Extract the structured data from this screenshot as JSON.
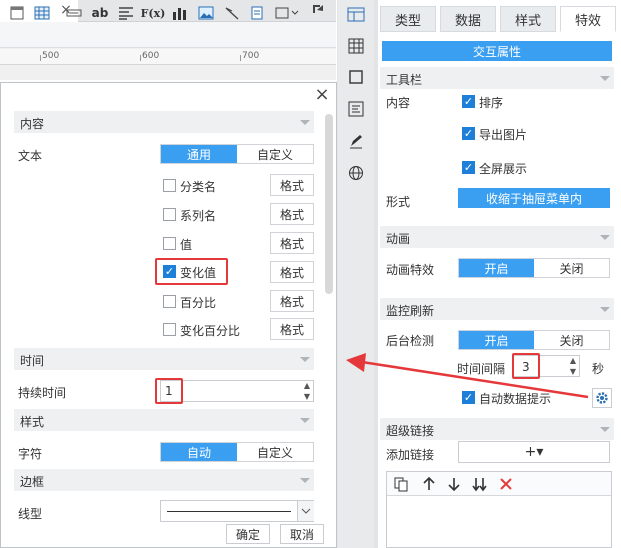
{
  "toolbar": {
    "tools": [
      "grid-icon",
      "table-icon",
      "link-icon",
      "ab",
      "text-align-icon",
      "F(x)",
      "bar-chart-icon",
      "image-icon",
      "line-icon",
      "page-icon",
      "frame-icon"
    ],
    "ab_label": "ab",
    "fx_label": "F(x)",
    "ruler": [
      "500",
      "600",
      "700"
    ]
  },
  "dialog": {
    "sections": {
      "content": "内容",
      "time": "时间",
      "style": "样式",
      "border": "边框"
    },
    "text_label": "文本",
    "text_modes": [
      "通用",
      "自定义"
    ],
    "text_mode_selected": "通用",
    "items": [
      {
        "label": "分类名",
        "checked": false,
        "format": "格式"
      },
      {
        "label": "系列名",
        "checked": false,
        "format": "格式"
      },
      {
        "label": "值",
        "checked": false,
        "format": "格式"
      },
      {
        "label": "变化值",
        "checked": true,
        "format": "格式"
      },
      {
        "label": "百分比",
        "checked": false,
        "format": "格式"
      },
      {
        "label": "变化百分比",
        "checked": false,
        "format": "格式"
      }
    ],
    "duration_label": "持续时间",
    "duration_value": "1",
    "font_label": "字符",
    "font_modes": [
      "自动",
      "自定义"
    ],
    "linetype_label": "线型",
    "ok": "确定",
    "cancel": "取消"
  },
  "side_icons": [
    "layout-icon",
    "table-grid-icon",
    "square-icon",
    "form-icon",
    "pencil-icon",
    "globe-icon"
  ],
  "panel": {
    "tabs": [
      "类型",
      "数据",
      "样式",
      "特效"
    ],
    "active_tab": "特效",
    "interactive_attr": "交互属性",
    "toolbar_section": "工具栏",
    "content_label": "内容",
    "content_checks": [
      {
        "label": "排序",
        "checked": true
      },
      {
        "label": "导出图片",
        "checked": true
      },
      {
        "label": "全屏展示",
        "checked": true
      }
    ],
    "form_label": "形式",
    "form_value": "收缩于抽屉菜单内",
    "animation_section": "动画",
    "animation_label": "动画特效",
    "animation_options": [
      "开启",
      "关闭"
    ],
    "monitor_section": "监控刷新",
    "backend_label": "后台检测",
    "backend_options": [
      "开启",
      "关闭"
    ],
    "interval_label": "时间间隔",
    "interval_value": "3",
    "interval_unit": "秒",
    "auto_tip_label": "自动数据提示",
    "auto_tip_checked": true,
    "hyperlink_section": "超级链接",
    "add_link_label": "添加链接",
    "add_link_plus": "+▾"
  },
  "colors": {
    "accent": "#3b9ff1",
    "check": "#1e7fd9",
    "highlight": "#e5383b",
    "section_bg": "#eef0f2"
  }
}
